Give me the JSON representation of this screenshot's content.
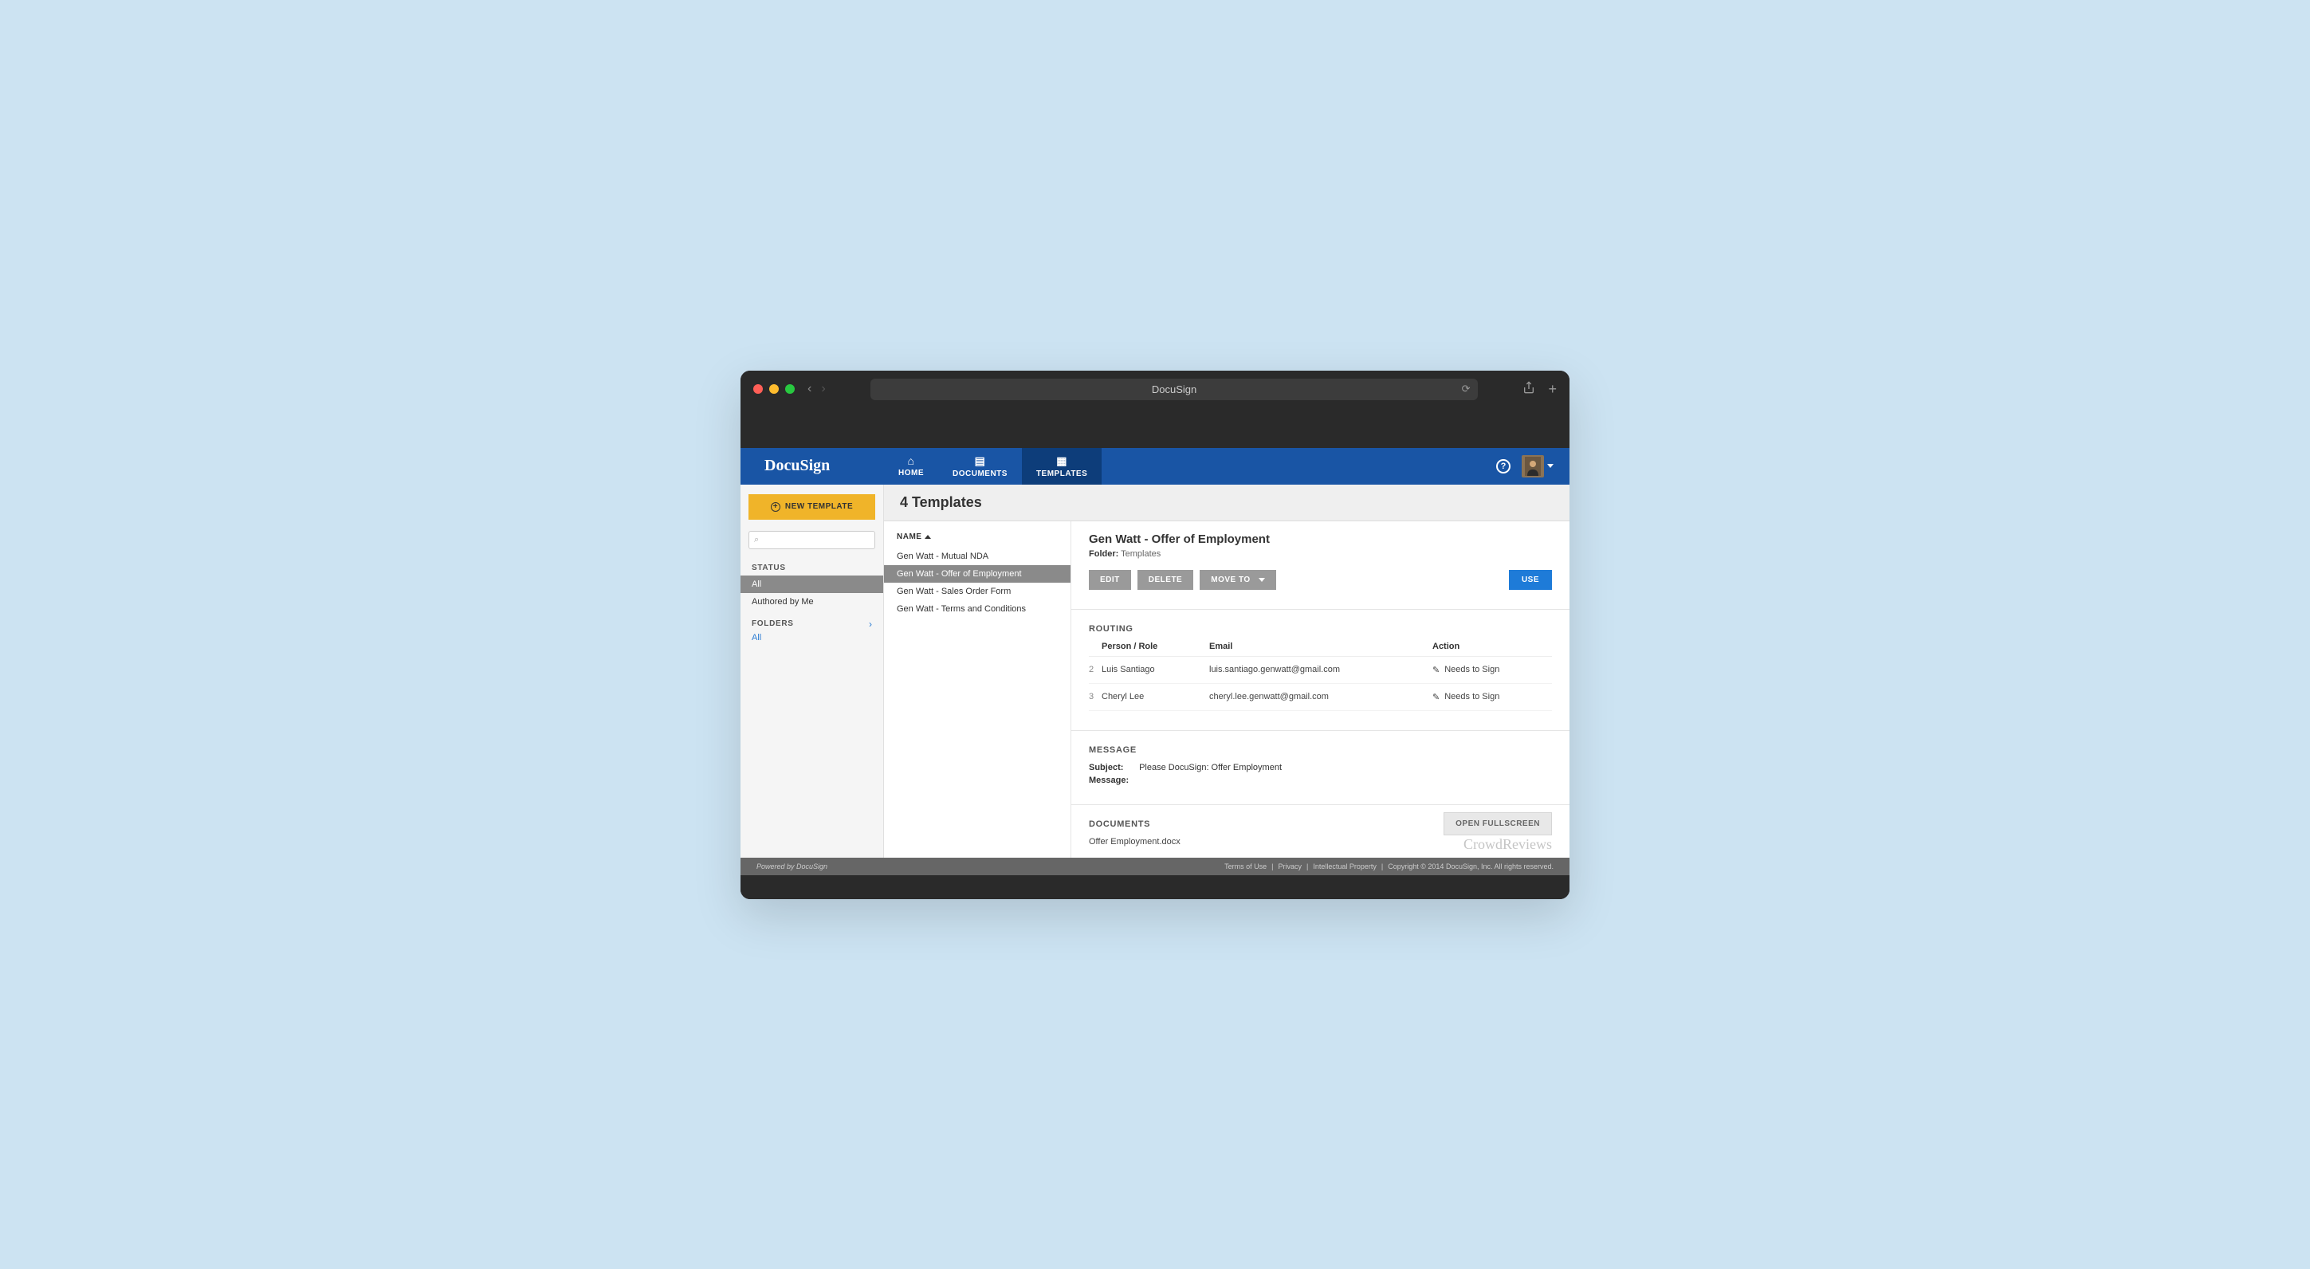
{
  "browser": {
    "title": "DocuSign"
  },
  "header": {
    "logo": "DocuSign",
    "nav": [
      {
        "label": "HOME"
      },
      {
        "label": "DOCUMENTS"
      },
      {
        "label": "TEMPLATES"
      }
    ]
  },
  "sidebar": {
    "newTemplate": "NEW TEMPLATE",
    "statusHeading": "STATUS",
    "statusItems": [
      "All",
      "Authored by Me"
    ],
    "foldersHeading": "FOLDERS",
    "foldersLink": "All"
  },
  "page": {
    "title": "4 Templates",
    "listHeader": "NAME",
    "templates": [
      "Gen Watt - Mutual NDA",
      "Gen Watt - Offer of Employment",
      "Gen Watt - Sales Order Form",
      "Gen Watt - Terms and Conditions"
    ]
  },
  "detail": {
    "title": "Gen Watt - Offer of Employment",
    "folderLabel": "Folder:",
    "folderValue": "Templates",
    "buttons": {
      "edit": "EDIT",
      "delete": "DELETE",
      "moveTo": "MOVE TO",
      "use": "USE"
    },
    "routing": {
      "heading": "ROUTING",
      "cols": {
        "person": "Person / Role",
        "email": "Email",
        "action": "Action"
      },
      "rows": [
        {
          "idx": "2",
          "person": "Luis Santiago",
          "email": "luis.santiago.genwatt@gmail.com",
          "action": "Needs to Sign"
        },
        {
          "idx": "3",
          "person": "Cheryl Lee",
          "email": "cheryl.lee.genwatt@gmail.com",
          "action": "Needs to Sign"
        }
      ]
    },
    "message": {
      "heading": "MESSAGE",
      "subjectLabel": "Subject:",
      "subjectValue": "Please DocuSign: Offer Employment",
      "messageLabel": "Message:"
    },
    "documents": {
      "heading": "DOCUMENTS",
      "file": "Offer Employment.docx"
    },
    "openFullscreen": "OPEN FULLSCREEN",
    "watermark": "CrowdReviews"
  },
  "footer": {
    "powered": "Powered by DocuSign",
    "links": [
      "Terms of Use",
      "Privacy",
      "Intellectual Property"
    ],
    "copyright": "Copyright © 2014 DocuSign, Inc. All rights reserved."
  }
}
